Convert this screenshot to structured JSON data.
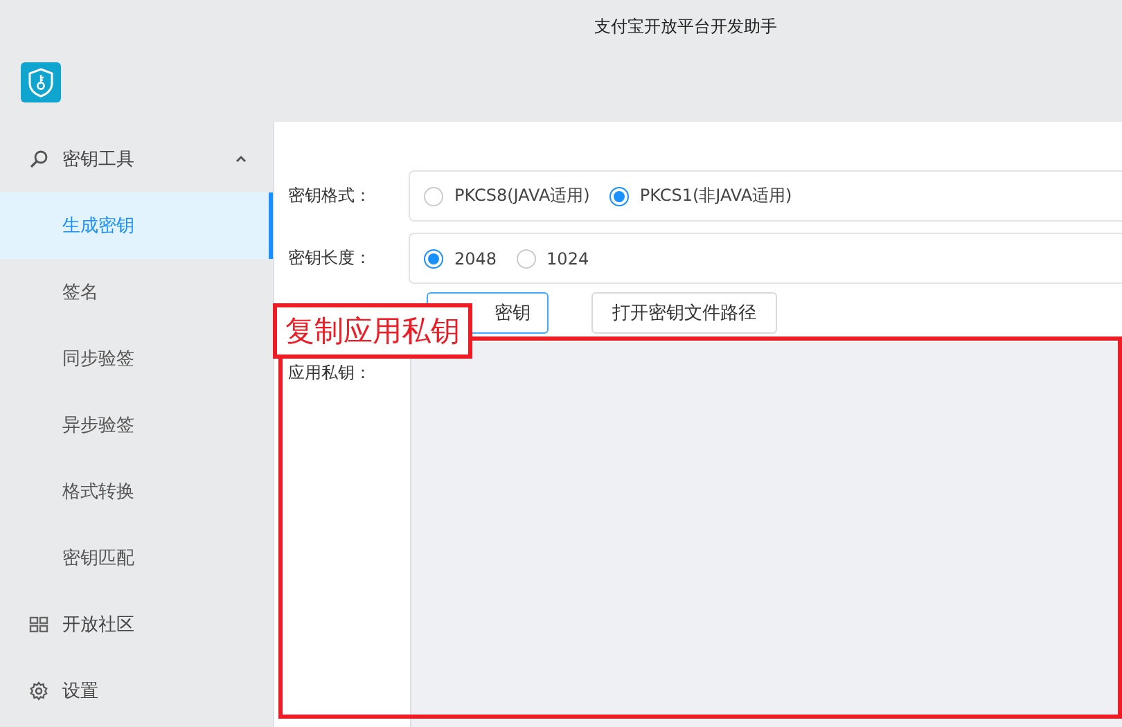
{
  "window": {
    "title": "支付宝开放平台开发助手"
  },
  "sidebar": {
    "items": [
      {
        "label": "密钥工具",
        "kind": "search",
        "expanded": true,
        "children": [
          {
            "label": "生成密钥",
            "selected": true
          },
          {
            "label": "签名",
            "selected": false
          },
          {
            "label": "同步验签",
            "selected": false
          },
          {
            "label": "异步验签",
            "selected": false
          },
          {
            "label": "格式转换",
            "selected": false
          },
          {
            "label": "密钥匹配",
            "selected": false
          }
        ]
      },
      {
        "label": "开放社区",
        "kind": "grid"
      },
      {
        "label": "设置",
        "kind": "gear"
      }
    ]
  },
  "form": {
    "fields": [
      {
        "label": "密钥格式：",
        "options": [
          {
            "label": "PKCS8(JAVA适用)",
            "selected": false
          },
          {
            "label": "PKCS1(非JAVA适用)",
            "selected": true
          }
        ]
      },
      {
        "label": "密钥长度：",
        "options": [
          {
            "label": "2048",
            "selected": true
          },
          {
            "label": "1024",
            "selected": false
          }
        ]
      }
    ],
    "buttons": [
      {
        "label": "密钥",
        "kind": "primary"
      },
      {
        "label": "打开密钥文件路径",
        "kind": "default"
      }
    ],
    "private_key": {
      "label": "应用私钥："
    }
  },
  "annotation": {
    "text": "复制应用私钥"
  }
}
